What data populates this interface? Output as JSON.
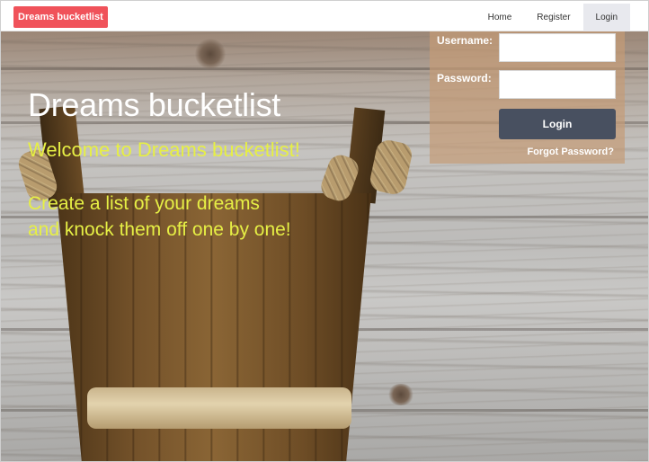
{
  "navbar": {
    "brand": "Dreams bucketlist",
    "links": [
      {
        "label": "Home",
        "active": false
      },
      {
        "label": "Register",
        "active": false
      },
      {
        "label": "Login",
        "active": true
      }
    ]
  },
  "hero": {
    "title": "Dreams bucketlist",
    "welcome": "Welcome to Dreams bucketlist!",
    "tagline_lines": [
      "Create a list of your dreams",
      "and knock them off one by one!"
    ]
  },
  "login_form": {
    "username_label": "Username:",
    "username_value": "",
    "password_label": "Password:",
    "password_value": "",
    "submit_label": "Login",
    "forgot_password": "Forgot Password?"
  },
  "colors": {
    "brand_badge": "#f0525a",
    "hero_title": "#ffffff",
    "hero_text": "#e6ef45",
    "login_panel": "#c49b76",
    "login_button": "#485060",
    "active_nav": "#e8e9ee"
  },
  "icons": []
}
